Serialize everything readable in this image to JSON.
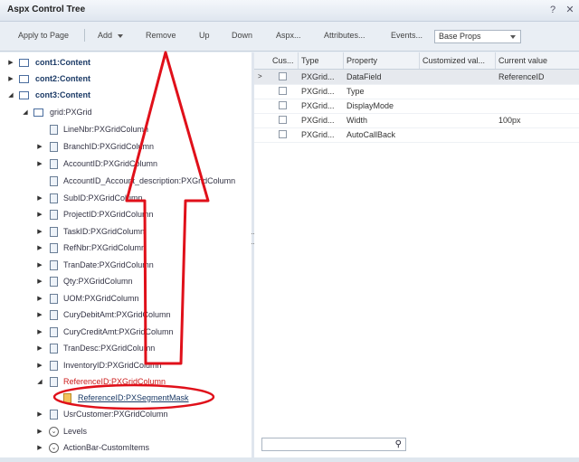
{
  "window": {
    "title": "Aspx Control Tree",
    "help_glyph": "?",
    "close_glyph": "✕"
  },
  "toolbar": {
    "apply_label": "Apply to Page",
    "add_label": "Add",
    "remove_label": "Remove",
    "up_label": "Up",
    "down_label": "Down",
    "aspx_label": "Aspx...",
    "attributes_label": "Attributes...",
    "events_label": "Events...",
    "props_selected": "Base Props"
  },
  "tree": {
    "nodes": [
      {
        "label": "cont1:Content"
      },
      {
        "label": "cont2:Content"
      },
      {
        "label": "cont3:Content"
      },
      {
        "label": "grid:PXGrid"
      },
      {
        "label": "LineNbr:PXGridColumn"
      },
      {
        "label": "BranchID:PXGridColumn"
      },
      {
        "label": "AccountID:PXGridColumn"
      },
      {
        "label": "AccountID_Account_description:PXGridColumn"
      },
      {
        "label": "SubID:PXGridColumn"
      },
      {
        "label": "ProjectID:PXGridColumn"
      },
      {
        "label": "TaskID:PXGridColumn"
      },
      {
        "label": "RefNbr:PXGridColumn"
      },
      {
        "label": "TranDate:PXGridColumn"
      },
      {
        "label": "Qty:PXGridColumn"
      },
      {
        "label": "UOM:PXGridColumn"
      },
      {
        "label": "CuryDebitAmt:PXGridColumn"
      },
      {
        "label": "CuryCreditAmt:PXGridColumn"
      },
      {
        "label": "TranDesc:PXGridColumn"
      },
      {
        "label": "InventoryID:PXGridColumn"
      },
      {
        "label": "ReferenceID:PXGridColumn"
      },
      {
        "label": "ReferenceID:PXSegmentMask"
      },
      {
        "label": "UsrCustomer:PXGridColumn"
      },
      {
        "label": "Levels"
      },
      {
        "label": "ActionBar-CustomItems"
      }
    ]
  },
  "grid": {
    "headers": [
      "Cus...",
      "Type",
      "Property",
      "Customized val...",
      "Current value"
    ],
    "rows": [
      {
        "type": "PXGrid...",
        "property": "DataField",
        "customized": "",
        "current": "ReferenceID"
      },
      {
        "type": "PXGrid...",
        "property": "Type",
        "customized": "",
        "current": ""
      },
      {
        "type": "PXGrid...",
        "property": "DisplayMode",
        "customized": "",
        "current": ""
      },
      {
        "type": "PXGrid...",
        "property": "Width",
        "customized": "",
        "current": "100px"
      },
      {
        "type": "PXGrid...",
        "property": "AutoCallBack",
        "customized": "",
        "current": ""
      }
    ],
    "search_value": ""
  },
  "colors": {
    "annotation": "#e0101a",
    "selected_node": "#cc1a1a"
  }
}
